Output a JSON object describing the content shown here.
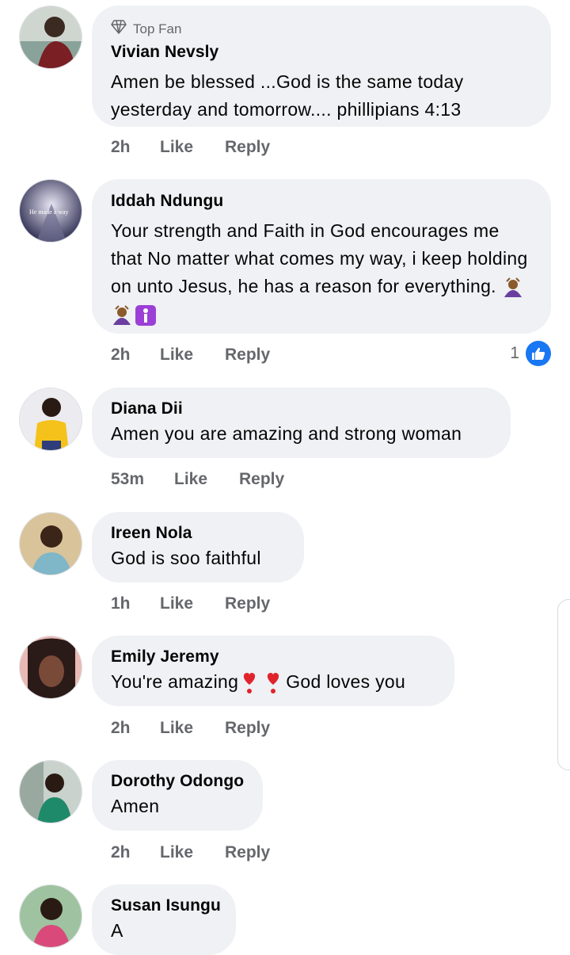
{
  "comments": [
    {
      "badge": "Top Fan",
      "name": "Vivian Nevsly",
      "text": "Amen be blessed ...God is the same today yesterday and tomorrow.... phillipians 4:13",
      "time": "2h",
      "like": "Like",
      "reply": "Reply"
    },
    {
      "name": "Iddah Ndungu",
      "text": "Your strength and Faith in God encourages me that No matter what comes my way, i keep holding on unto Jesus, he has a reason for everything.",
      "avatar_caption": "He made a way",
      "time": "2h",
      "like": "Like",
      "reply": "Reply",
      "reaction_count": "1"
    },
    {
      "name": "Diana Dii",
      "text": "Amen you are amazing and strong woman",
      "time": "53m",
      "like": "Like",
      "reply": "Reply"
    },
    {
      "name": "Ireen Nola",
      "text": "God is soo faithful",
      "time": "1h",
      "like": "Like",
      "reply": "Reply"
    },
    {
      "name": "Emily Jeremy",
      "text_a": "You're amazing",
      "text_b": "God loves you",
      "time": "2h",
      "like": "Like",
      "reply": "Reply"
    },
    {
      "name": "Dorothy Odongo",
      "text": "Amen",
      "time": "2h",
      "like": "Like",
      "reply": "Reply"
    },
    {
      "name": "Susan Isungu",
      "text": "A"
    }
  ],
  "colors": {
    "bubble": "#eff1f4",
    "like_blue": "#1877f2",
    "meta": "#65676b"
  },
  "icons": [
    "diamond-icon",
    "like-thumb-icon",
    "bowing-person-emoji",
    "person-raising-hand-emoji",
    "red-heart-exclamation-emoji"
  ]
}
